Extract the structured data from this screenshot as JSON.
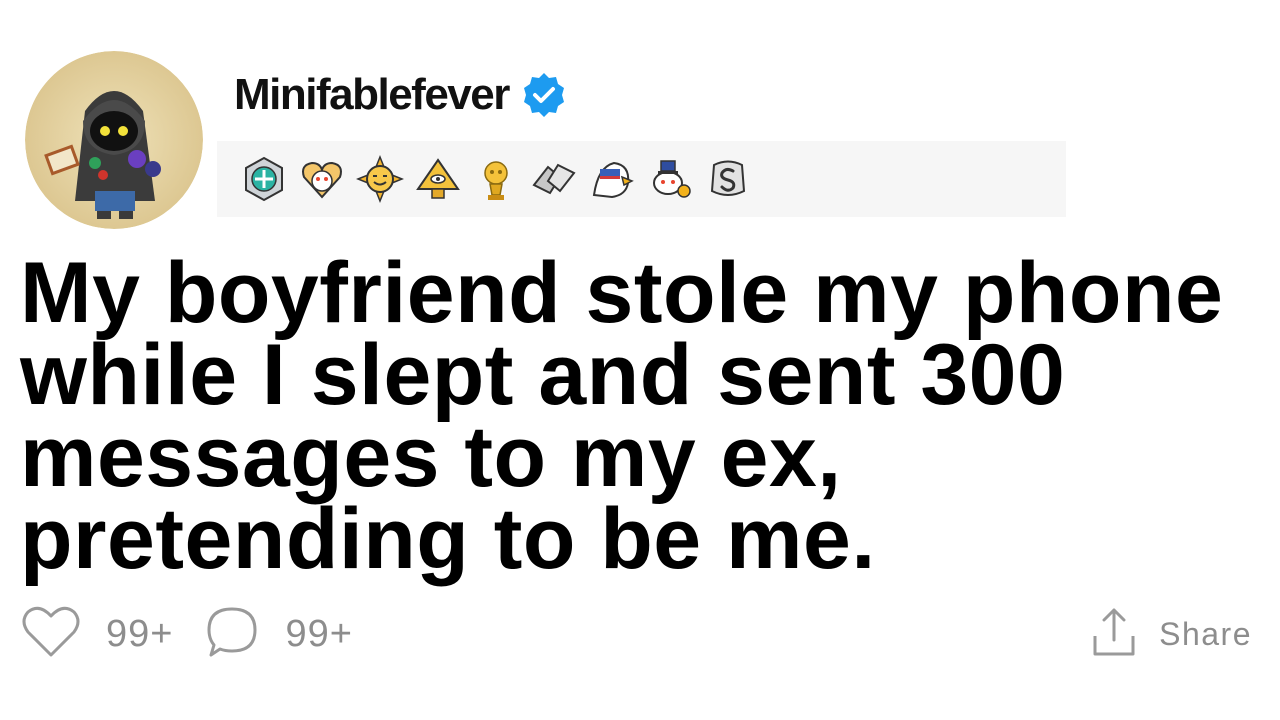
{
  "post": {
    "username": "Minifablefever",
    "title": "My boyfriend stole my phone while I slept and sent 300 messages to my ex, pretending to be me."
  },
  "actions": {
    "likes_count": "99+",
    "comments_count": "99+",
    "share_label": "Share"
  },
  "icons": {
    "verified": "verified-badge-icon",
    "like": "heart-icon",
    "comment": "comment-bubble-icon",
    "share": "share-icon"
  },
  "awards": [
    "helpful-award",
    "wholesome-award",
    "sun-award",
    "pyramid-award",
    "gold-award",
    "handshake-award",
    "eagle-award",
    "rocket-like-award",
    "silver-award"
  ],
  "colors": {
    "verified_blue": "#1d9bf0",
    "text": "#000000",
    "muted": "#8d8d8d",
    "award_bar": "#f6f6f6"
  }
}
